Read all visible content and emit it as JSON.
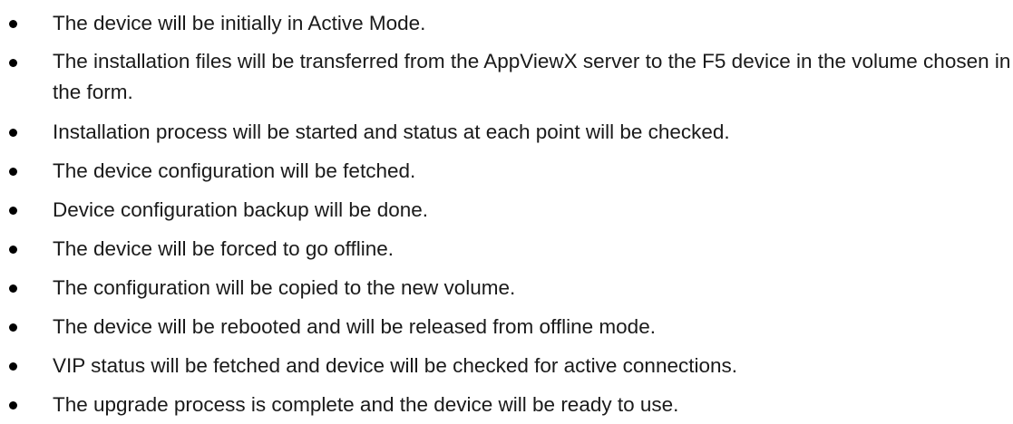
{
  "bullet_list": {
    "items": [
      "The device will be initially in Active Mode.",
      "The installation files will be transferred from the AppViewX server to the F5 device in the volume chosen in the form.",
      "Installation process will be started and status at each point will be checked.",
      "The device configuration will be fetched.",
      "Device configuration backup will be done.",
      "The device will be forced to go offline.",
      "The configuration will be copied to the new volume.",
      "The device will be rebooted and will be released from offline mode.",
      "VIP status will be fetched and device will be checked for active connections.",
      "The upgrade process is complete and the device will be ready to use."
    ]
  }
}
